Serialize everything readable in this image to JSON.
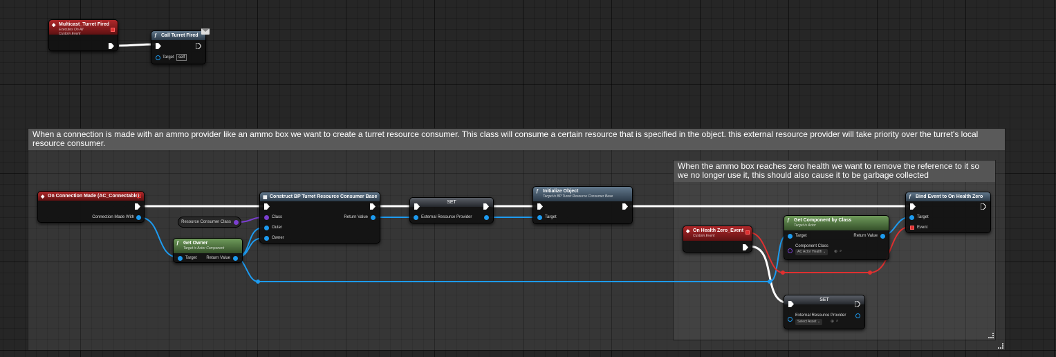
{
  "comments": {
    "main": "When a connection is made with an ammo provider like an ammo box we want to create a turret resource consumer. This class will consume a certain resource that is specified in the object. this external resource provider will take priority over the turret's local resource consumer.",
    "zero_health": "When the ammo box reaches zero health we want to remove the reference to it so we no longer use it, this should also cause it to be garbage collected"
  },
  "multicast_event": {
    "title": "Multicast_Turret Fired",
    "subtitle1": "Executes On All",
    "subtitle2": "Custom Event"
  },
  "call_turret": {
    "title": "Call Turret Fired",
    "target_label": "Target",
    "target_value": "self"
  },
  "on_connection": {
    "title": "On Connection Made (AC_Connectable)",
    "pin_label": "Connection Made With"
  },
  "resource_class_var": {
    "label": "Resource Consumer Class"
  },
  "get_owner": {
    "title": "Get Owner",
    "subtitle": "Target is Actor Component",
    "target_label": "Target",
    "return_label": "Return Value"
  },
  "construct": {
    "title": "Construct BP Turret Resource Consumer Base",
    "class_label": "Class",
    "outer_label": "Outer",
    "owner_label": "Owner",
    "return_label": "Return Value"
  },
  "set1": {
    "title": "SET",
    "pin_label": "External Resource Provider"
  },
  "initialize": {
    "title": "Initialize Object",
    "subtitle": "Target is BP Turret Resource Consumer Base",
    "target_label": "Target"
  },
  "on_health_zero": {
    "title": "On Health Zero_Event",
    "subtitle": "Custom Event"
  },
  "get_component": {
    "title": "Get Component by Class",
    "subtitle": "Target is Actor",
    "target_label": "Target",
    "class_label": "Component Class",
    "class_value": "AC Actor Health",
    "return_label": "Return Value"
  },
  "bind_event": {
    "title": "Bind Event to On Health Zero",
    "target_label": "Target",
    "event_label": "Event"
  },
  "set2": {
    "title": "SET",
    "pin_label": "External Resource Provider",
    "select_value": "Select Asset"
  },
  "colors": {
    "exec_wire": "#ffffff",
    "object_wire": "#1d9bf0",
    "class_wire": "#7b3fd1",
    "delegate_wire": "#e03030"
  }
}
